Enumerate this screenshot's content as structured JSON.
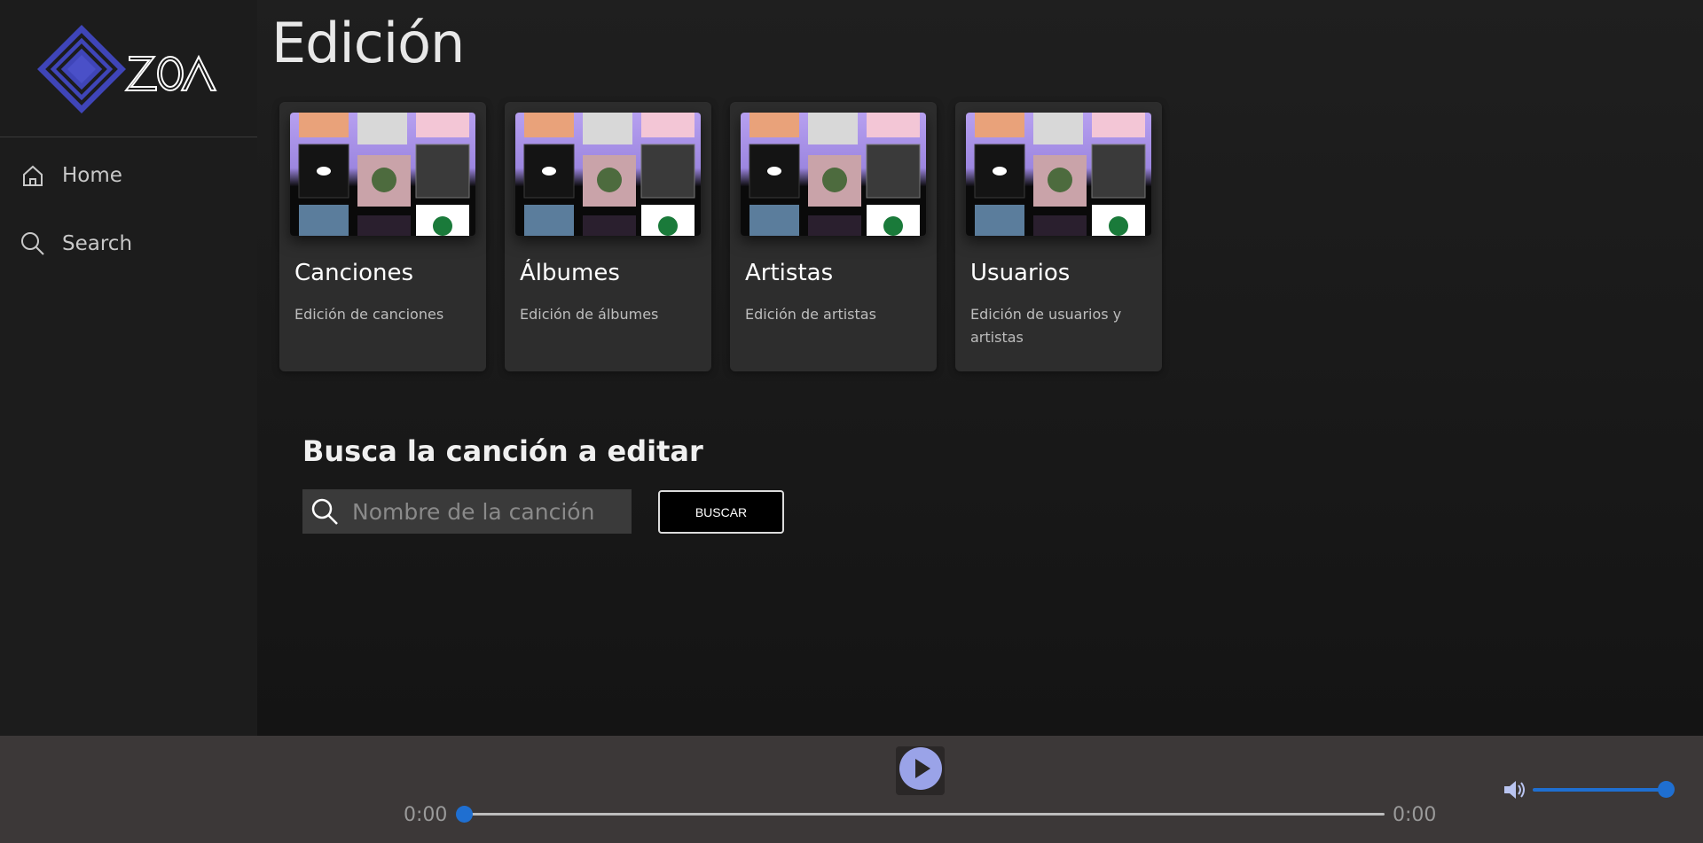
{
  "app": {
    "logo_text": "ZOA",
    "accent_color": "#4a50c8"
  },
  "sidebar": {
    "items": [
      {
        "label": "Home",
        "icon": "home-icon"
      },
      {
        "label": "Search",
        "icon": "search-icon"
      }
    ]
  },
  "main": {
    "title": "Edición",
    "cards": [
      {
        "title": "Canciones",
        "description": "Edición de canciones"
      },
      {
        "title": "Álbumes",
        "description": "Edición de álbumes"
      },
      {
        "title": "Artistas",
        "description": "Edición de artistas"
      },
      {
        "title": "Usuarios",
        "description": "Edición de usuarios y artistas"
      }
    ],
    "search": {
      "heading": "Busca la canción a editar",
      "placeholder": "Nombre de la canción",
      "value": "",
      "button_label": "BUSCAR"
    }
  },
  "player": {
    "current_time": "0:00",
    "duration": "0:00",
    "progress": 0,
    "volume": 1.0,
    "play_icon": "play-icon",
    "volume_icon": "volume-icon",
    "accent_color": "#1f6fd1"
  }
}
